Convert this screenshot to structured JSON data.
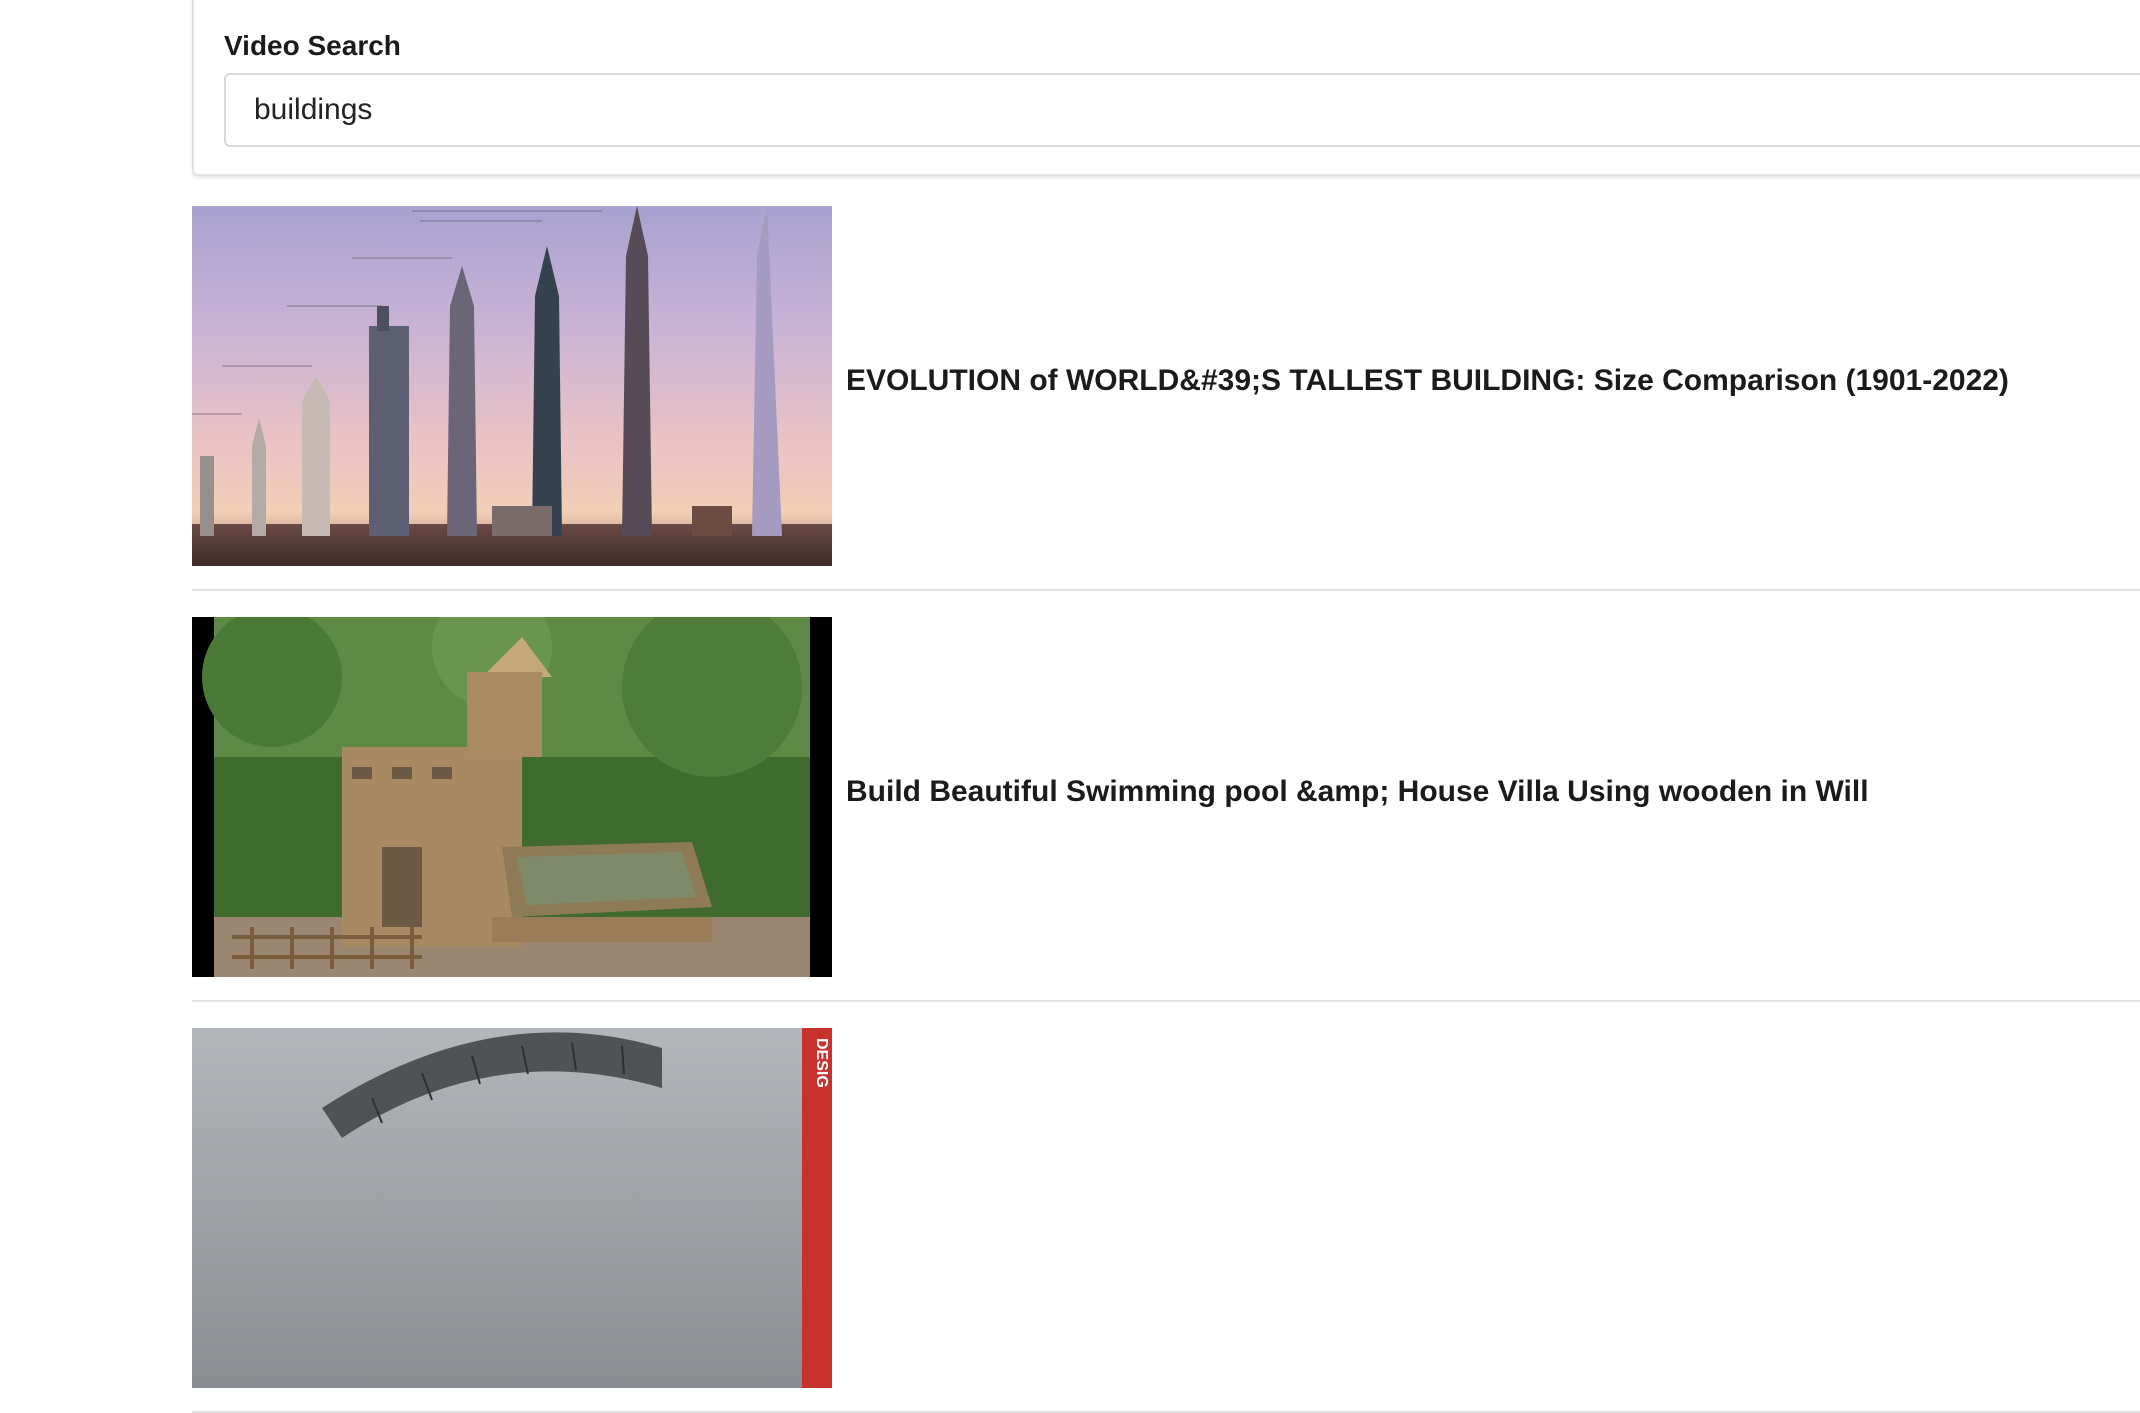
{
  "search": {
    "label": "Video Search",
    "value": "buildings"
  },
  "results": [
    {
      "title": "EVOLUTION of WORLD&#39;S TALLEST BUILDING: Size Comparison (1901-2022)",
      "thumbnail_icon": "skyscrapers-thumbnail"
    },
    {
      "title": "Build Beautiful Swimming pool &amp; House Villa Using wooden in Will",
      "thumbnail_icon": "jungle-villa-thumbnail"
    },
    {
      "title": "",
      "thumbnail_icon": "design-arch-thumbnail",
      "thumbnail_badge": "DESIG"
    }
  ]
}
